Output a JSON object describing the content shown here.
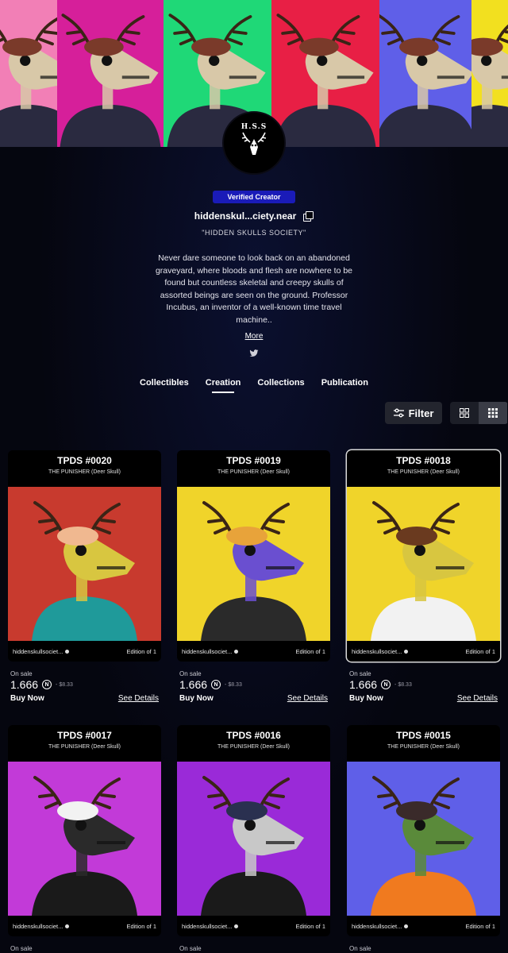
{
  "banner": {
    "tiles": [
      {
        "bg": "#f27fb6"
      },
      {
        "bg": "#d61f9a"
      },
      {
        "bg": "#1fd877"
      },
      {
        "bg": "#e81f45"
      },
      {
        "bg": "#5f5fe8"
      },
      {
        "bg": "#f2e01f"
      }
    ]
  },
  "avatar": {
    "logo_text": "H.S.S"
  },
  "profile": {
    "badge": "Verified Creator",
    "username": "hiddenskul...ciety.near",
    "tagline": "\"HIDDEN SKULLS SOCIETY\"",
    "bio": "Never dare someone to look back on an abandoned graveyard, where bloods and flesh are nowhere to be found but countless skeletal and creepy skulls of assorted beings are seen on the ground. Professor Incubus, an inventor of a well-known time travel machine..",
    "more": "More"
  },
  "tabs": [
    "Collectibles",
    "Creation",
    "Collections",
    "Publication"
  ],
  "filter_label": "Filter",
  "cards": [
    {
      "title": "TPDS #0020",
      "subtitle": "THE PUNISHER (Deer Skull)",
      "owner": "hiddenskullsociet...",
      "edition": "Edition of 1",
      "on_sale": "On sale",
      "price": "1.666",
      "usd": "- $8.33",
      "buy": "Buy Now",
      "details": "See Details",
      "bg": "#c83a2e",
      "skull": "#d8c640",
      "outfit": "#1f9a9a",
      "hat": "#f0b890"
    },
    {
      "title": "TPDS #0019",
      "subtitle": "THE PUNISHER (Deer Skull)",
      "owner": "hiddenskullsociet...",
      "edition": "Edition of 1",
      "on_sale": "On sale",
      "price": "1.666",
      "usd": "- $8.33",
      "buy": "Buy Now",
      "details": "See Details",
      "bg": "#f0d42a",
      "skull": "#6a4fd0",
      "outfit": "#2a2a2a",
      "hat": "#e8a33a"
    },
    {
      "title": "TPDS #0018",
      "subtitle": "THE PUNISHER (Deer Skull)",
      "owner": "hiddenskullsociet...",
      "edition": "Edition of 1",
      "on_sale": "On sale",
      "price": "1.666",
      "usd": "- $8.33",
      "buy": "Buy Now",
      "details": "See Details",
      "bg": "#f0d42a",
      "skull": "#d8c640",
      "outfit": "#f2f2f2",
      "hat": "#6a3a1f"
    },
    {
      "title": "TPDS #0017",
      "subtitle": "THE PUNISHER (Deer Skull)",
      "owner": "hiddenskullsociet...",
      "edition": "Edition of 1",
      "on_sale": "On sale",
      "price": "",
      "usd": "",
      "buy": "",
      "details": "",
      "bg": "#c23ad8",
      "skull": "#2a2a2a",
      "outfit": "#1a1a1a",
      "hat": "#f2f2f2"
    },
    {
      "title": "TPDS #0016",
      "subtitle": "THE PUNISHER (Deer Skull)",
      "owner": "hiddenskullsociet...",
      "edition": "Edition of 1",
      "on_sale": "On sale",
      "price": "",
      "usd": "",
      "buy": "",
      "details": "",
      "bg": "#9a2ad8",
      "skull": "#c8c8c8",
      "outfit": "#1a1a1a",
      "hat": "#2a3050"
    },
    {
      "title": "TPDS #0015",
      "subtitle": "THE PUNISHER (Deer Skull)",
      "owner": "hiddenskullsociet...",
      "edition": "Edition of 1",
      "on_sale": "On sale",
      "price": "",
      "usd": "",
      "buy": "",
      "details": "",
      "bg": "#5f5fe8",
      "skull": "#5a8a3a",
      "outfit": "#f07a1f",
      "hat": "#3a2a2a"
    }
  ]
}
